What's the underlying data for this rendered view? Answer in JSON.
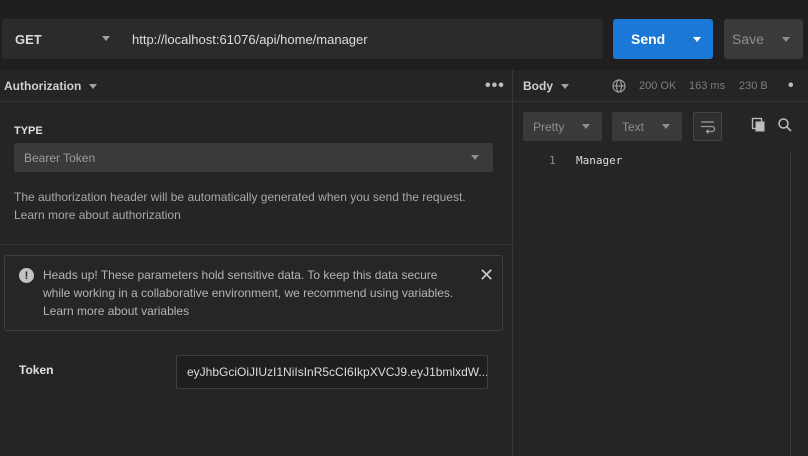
{
  "request": {
    "method": "GET",
    "url": "http://localhost:61076/api/home/manager",
    "send_label": "Send",
    "save_label": "Save"
  },
  "left_panel": {
    "tab_label": "Authorization",
    "type_label": "TYPE",
    "auth_type": "Bearer Token",
    "description_line1": "The authorization header will be automatically generated when you send the request.",
    "description_line2": "Learn more about authorization",
    "alert": {
      "text": "Heads up! These parameters hold sensitive data. To keep this data secure while working in a collaborative environment, we recommend using variables. Learn more about variables"
    },
    "token_label": "Token",
    "token_value": "eyJhbGciOiJIUzI1NiIsInR5cCI6IkpXVCJ9.eyJ1bmlxdW..."
  },
  "right_panel": {
    "tab_label": "Body",
    "status": "200 OK",
    "time": "163 ms",
    "size": "230 B",
    "format_label": "Pretty",
    "content_type_label": "Text",
    "response_lines": [
      {
        "line": "1",
        "text": "Manager"
      }
    ]
  },
  "colors": {
    "accent": "#1b78d6",
    "background": "#252525",
    "topbar": "#1f1f1f"
  },
  "icons": [
    "chevron-down-icon",
    "more-icon",
    "globe-icon",
    "wrap-icon",
    "copy-icon",
    "search-icon",
    "info-icon",
    "close-icon"
  ]
}
